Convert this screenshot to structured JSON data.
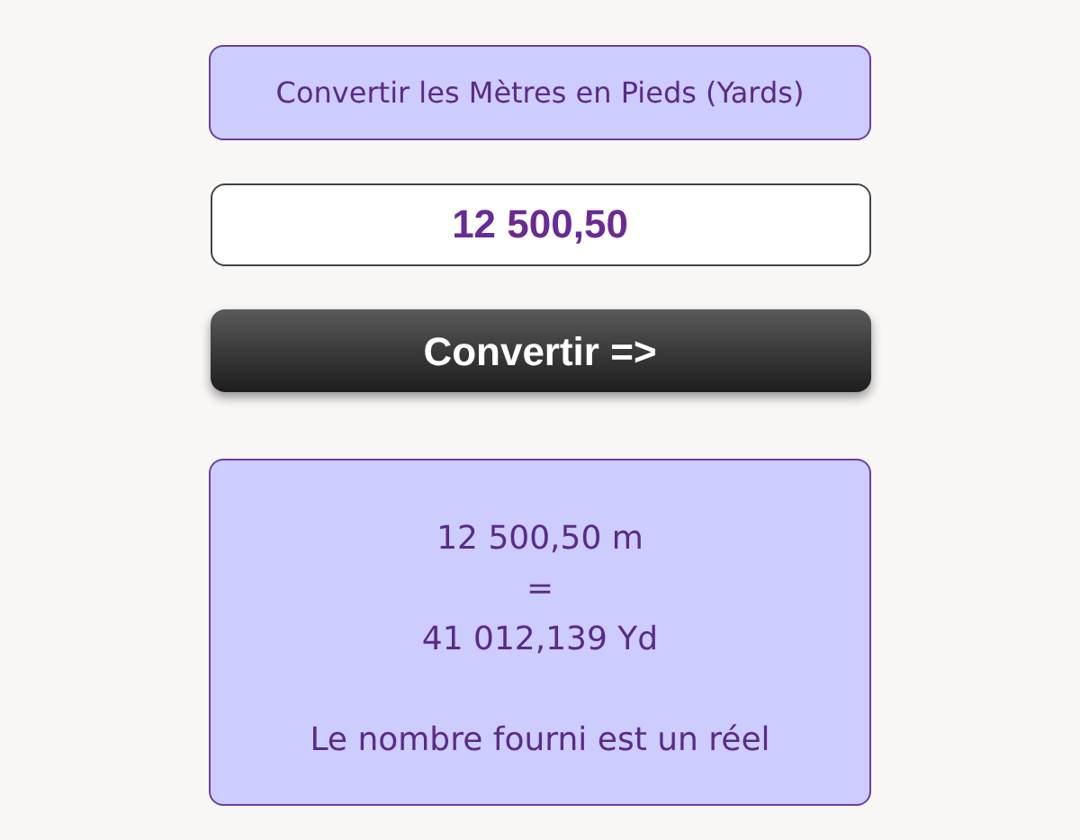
{
  "title": "Convertir les Mètres en Pieds (Yards)",
  "input": {
    "value": "12 500,50"
  },
  "button": "Convertir =>",
  "result": {
    "lines": [
      "12 500,50 m",
      "=",
      "41 012,139 Yd"
    ],
    "message": "Le nombre fourni est un réel"
  }
}
